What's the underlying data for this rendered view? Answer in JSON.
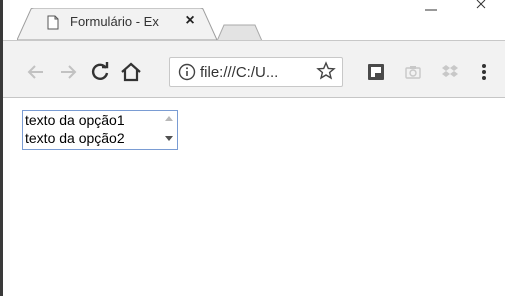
{
  "tab": {
    "title": "Formulário - Ex",
    "close_label": "×"
  },
  "toolbar": {
    "back_icon": "arrow-left-icon",
    "forward_icon": "arrow-right-icon",
    "reload_icon": "reload-icon",
    "home_icon": "home-icon",
    "url": "file:///C:/U...",
    "bookmark_icon": "star-icon",
    "menu_icon": "vertical-dots-icon"
  },
  "listbox": {
    "options": [
      "texto da opção1",
      "texto da opção2"
    ]
  },
  "colors": {
    "tab_bg": "#f2f2f2",
    "toolbar_bg": "#f2f2f2",
    "listbox_border": "#7a9cd3"
  }
}
